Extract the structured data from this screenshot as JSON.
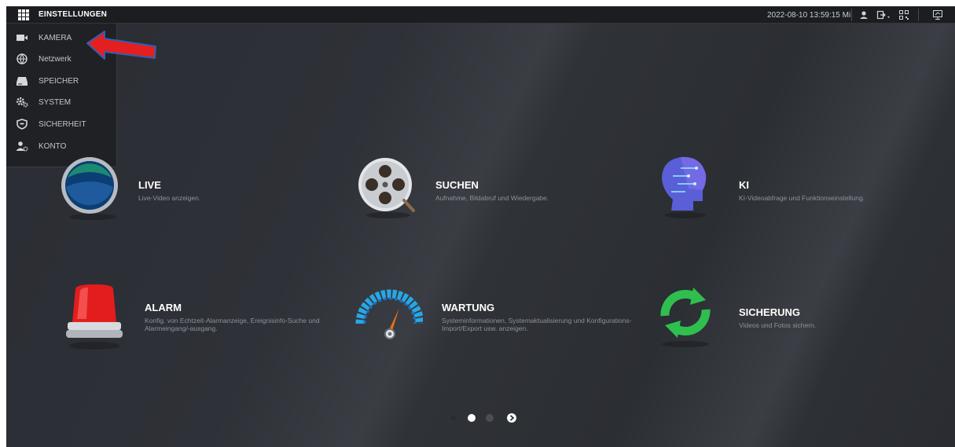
{
  "header": {
    "title": "EINSTELLUNGEN",
    "datetime": "2022-08-10 13:59:15 Mi",
    "icons": [
      "grid-menu-icon",
      "user-icon",
      "logout-icon",
      "qr-code-icon",
      "monitor-icon"
    ]
  },
  "menu": {
    "items": [
      {
        "label": "KAMERA",
        "icon": "camera-icon"
      },
      {
        "label": "Netzwerk",
        "icon": "network-icon"
      },
      {
        "label": "SPEICHER",
        "icon": "storage-icon"
      },
      {
        "label": "SYSTEM",
        "icon": "gears-icon"
      },
      {
        "label": "SICHERHEIT",
        "icon": "shield-icon"
      },
      {
        "label": "KONTO",
        "icon": "account-icon"
      }
    ]
  },
  "tiles": [
    {
      "title": "LIVE",
      "desc": "Live-Video anzeigen.",
      "icon": "live-icon"
    },
    {
      "title": "SUCHEN",
      "desc": "Aufnahme, Bildabruf und Wiedergabe.",
      "icon": "search-reel-icon"
    },
    {
      "title": "KI",
      "desc": "KI-Videoabfrage und Funktionseinstellung.",
      "icon": "ai-head-icon"
    },
    {
      "title": "ALARM",
      "desc": "Konfig. von Echtzeit-Alarmanzeige, Ereignisinfo-Suche und Alarmeingang/-ausgang.",
      "icon": "alarm-siren-icon"
    },
    {
      "title": "WARTUNG",
      "desc": "Systeminformationen, Systemaktualisierung und Konfigurations-Import/Export usw. anzeigen.",
      "icon": "gauge-icon"
    },
    {
      "title": "SICHERUNG",
      "desc": "Videos und Fotos sichern.",
      "icon": "backup-sync-icon"
    }
  ],
  "pager": {
    "pages": 2,
    "current": 1
  },
  "colors": {
    "annotation_arrow": "#e3201f",
    "arrow_outline": "#2f5fb3",
    "topbar": "#1b1d21"
  }
}
